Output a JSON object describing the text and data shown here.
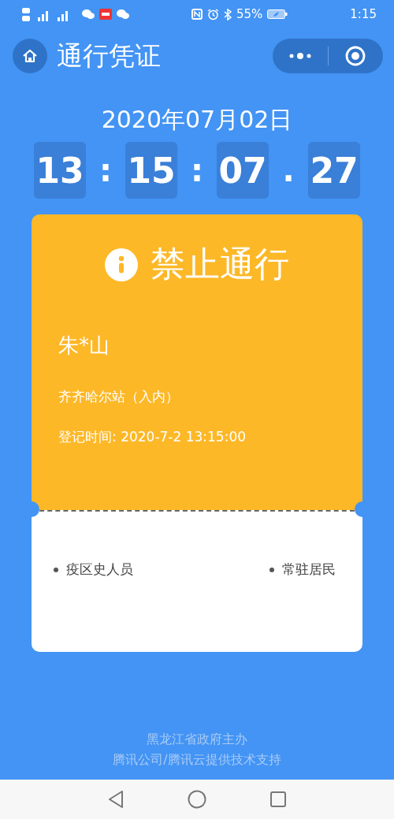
{
  "status_bar": {
    "battery_text": "55%",
    "clock": "1:15"
  },
  "header": {
    "title": "通行凭证"
  },
  "date": "2020年07月02日",
  "time": [
    {
      "kind": "digits",
      "text": "13"
    },
    {
      "kind": "separator",
      "text": ":"
    },
    {
      "kind": "digits",
      "text": "15"
    },
    {
      "kind": "separator",
      "text": ":"
    },
    {
      "kind": "digits",
      "text": "07"
    },
    {
      "kind": "separator",
      "text": "."
    },
    {
      "kind": "digits",
      "text": "27"
    }
  ],
  "pass": {
    "status": "禁止通行",
    "color": "#fdb827",
    "name": "朱*山",
    "station": "齐齐哈尔站（入内）",
    "registered": "登记时间: 2020-7-2 13:15:00",
    "tags": [
      {
        "text": "疫区史人员"
      },
      {
        "text": "常驻居民"
      }
    ]
  },
  "footer": [
    "黑龙江省政府主办",
    "腾讯公司/腾讯云提供技术支持"
  ]
}
